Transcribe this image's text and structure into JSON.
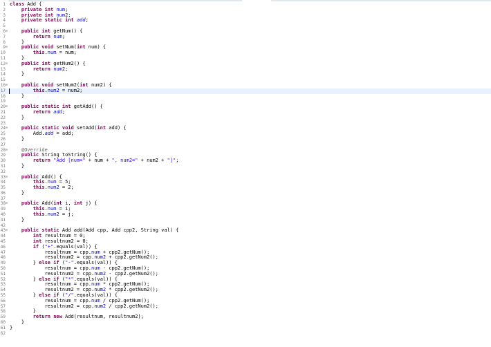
{
  "editor": {
    "colors": {
      "keyword": "#7f0055",
      "field": "#0000c0",
      "string": "#2a00ff",
      "annotation": "#646464",
      "current_line": "#e8f2fe",
      "line_number": "#787878"
    },
    "current_line_index": 16,
    "lines": [
      {
        "n": "1",
        "fold": "",
        "t": [
          [
            "kw",
            "class"
          ],
          [
            "p",
            " Add {"
          ]
        ]
      },
      {
        "n": "2",
        "fold": "",
        "t": [
          [
            "p",
            "    "
          ],
          [
            "kw",
            "private int"
          ],
          [
            "p",
            " "
          ],
          [
            "field",
            "num"
          ],
          [
            "p",
            ";"
          ]
        ]
      },
      {
        "n": "3",
        "fold": "",
        "t": [
          [
            "p",
            "    "
          ],
          [
            "kw",
            "private int"
          ],
          [
            "p",
            " "
          ],
          [
            "field",
            "num2"
          ],
          [
            "p",
            ";"
          ]
        ]
      },
      {
        "n": "4",
        "fold": "",
        "t": [
          [
            "p",
            "    "
          ],
          [
            "kw",
            "private static int"
          ],
          [
            "p",
            " "
          ],
          [
            "sfield",
            "add"
          ],
          [
            "p",
            ";"
          ]
        ]
      },
      {
        "n": "5",
        "fold": "",
        "t": [
          [
            "p",
            ""
          ]
        ]
      },
      {
        "n": "6",
        "fold": "⊖",
        "t": [
          [
            "p",
            "    "
          ],
          [
            "kw",
            "public int"
          ],
          [
            "p",
            " getNum() {"
          ]
        ]
      },
      {
        "n": "7",
        "fold": "",
        "t": [
          [
            "p",
            "        "
          ],
          [
            "kw",
            "return"
          ],
          [
            "p",
            " "
          ],
          [
            "field",
            "num"
          ],
          [
            "p",
            ";"
          ]
        ]
      },
      {
        "n": "8",
        "fold": "",
        "t": [
          [
            "p",
            "    }"
          ]
        ]
      },
      {
        "n": "9",
        "fold": "⊖",
        "t": [
          [
            "p",
            "    "
          ],
          [
            "kw",
            "public void"
          ],
          [
            "p",
            " setNum("
          ],
          [
            "kw",
            "int"
          ],
          [
            "p",
            " num) {"
          ]
        ]
      },
      {
        "n": "10",
        "fold": "",
        "t": [
          [
            "p",
            "        "
          ],
          [
            "kw",
            "this"
          ],
          [
            "p",
            "."
          ],
          [
            "field",
            "num"
          ],
          [
            "p",
            " = num;"
          ]
        ]
      },
      {
        "n": "11",
        "fold": "",
        "t": [
          [
            "p",
            "    }"
          ]
        ]
      },
      {
        "n": "12",
        "fold": "⊖",
        "t": [
          [
            "p",
            "    "
          ],
          [
            "kw",
            "public int"
          ],
          [
            "p",
            " getNum2() {"
          ]
        ]
      },
      {
        "n": "13",
        "fold": "",
        "t": [
          [
            "p",
            "        "
          ],
          [
            "kw",
            "return"
          ],
          [
            "p",
            " "
          ],
          [
            "field",
            "num2"
          ],
          [
            "p",
            ";"
          ]
        ]
      },
      {
        "n": "14",
        "fold": "",
        "t": [
          [
            "p",
            "    }"
          ]
        ]
      },
      {
        "n": "15",
        "fold": "",
        "t": [
          [
            "p",
            ""
          ]
        ]
      },
      {
        "n": "16",
        "fold": "⊖",
        "t": [
          [
            "p",
            "    "
          ],
          [
            "kw",
            "public void"
          ],
          [
            "p",
            " setNum2("
          ],
          [
            "kw",
            "int"
          ],
          [
            "p",
            " num2) {"
          ]
        ]
      },
      {
        "n": "17",
        "fold": "",
        "t": [
          [
            "p",
            "        "
          ],
          [
            "kw",
            "this"
          ],
          [
            "p",
            "."
          ],
          [
            "field",
            "num2"
          ],
          [
            "p",
            " = num2;"
          ]
        ]
      },
      {
        "n": "18",
        "fold": "",
        "t": [
          [
            "p",
            "    }"
          ]
        ]
      },
      {
        "n": "19",
        "fold": "",
        "t": [
          [
            "p",
            ""
          ]
        ]
      },
      {
        "n": "20",
        "fold": "⊖",
        "t": [
          [
            "p",
            "    "
          ],
          [
            "kw",
            "public static int"
          ],
          [
            "p",
            " getAdd() {"
          ]
        ]
      },
      {
        "n": "21",
        "fold": "",
        "t": [
          [
            "p",
            "        "
          ],
          [
            "kw",
            "return"
          ],
          [
            "p",
            " "
          ],
          [
            "sfield",
            "add"
          ],
          [
            "p",
            ";"
          ]
        ]
      },
      {
        "n": "22",
        "fold": "",
        "t": [
          [
            "p",
            "    }"
          ]
        ]
      },
      {
        "n": "23",
        "fold": "",
        "t": [
          [
            "p",
            ""
          ]
        ]
      },
      {
        "n": "24",
        "fold": "⊖",
        "t": [
          [
            "p",
            "    "
          ],
          [
            "kw",
            "public static void"
          ],
          [
            "p",
            " setAdd("
          ],
          [
            "kw",
            "int"
          ],
          [
            "p",
            " add) {"
          ]
        ]
      },
      {
        "n": "25",
        "fold": "",
        "t": [
          [
            "p",
            "        Add."
          ],
          [
            "sfield",
            "add"
          ],
          [
            "p",
            " = add;"
          ]
        ]
      },
      {
        "n": "26",
        "fold": "",
        "t": [
          [
            "p",
            "    }"
          ]
        ]
      },
      {
        "n": "27",
        "fold": "",
        "t": [
          [
            "p",
            ""
          ]
        ]
      },
      {
        "n": "28",
        "fold": "⊖",
        "t": [
          [
            "p",
            "    "
          ],
          [
            "ann",
            "@Override"
          ]
        ]
      },
      {
        "n": "29",
        "fold": "",
        "t": [
          [
            "p",
            "    "
          ],
          [
            "kw",
            "public"
          ],
          [
            "p",
            " String toString() {"
          ]
        ]
      },
      {
        "n": "30",
        "fold": "",
        "t": [
          [
            "p",
            "        "
          ],
          [
            "kw",
            "return"
          ],
          [
            "p",
            " "
          ],
          [
            "str",
            "\"Add [num=\""
          ],
          [
            "p",
            " + num + "
          ],
          [
            "str",
            "\", num2=\""
          ],
          [
            "p",
            " + num2 + "
          ],
          [
            "str",
            "\"]\""
          ],
          [
            "p",
            ";"
          ]
        ]
      },
      {
        "n": "31",
        "fold": "",
        "t": [
          [
            "p",
            "    }"
          ]
        ]
      },
      {
        "n": "32",
        "fold": "",
        "t": [
          [
            "p",
            ""
          ]
        ]
      },
      {
        "n": "33",
        "fold": "⊖",
        "t": [
          [
            "p",
            "    "
          ],
          [
            "kw",
            "public"
          ],
          [
            "p",
            " Add() {"
          ]
        ]
      },
      {
        "n": "34",
        "fold": "",
        "t": [
          [
            "p",
            "        "
          ],
          [
            "kw",
            "this"
          ],
          [
            "p",
            "."
          ],
          [
            "field",
            "num"
          ],
          [
            "p",
            " = 5;"
          ]
        ]
      },
      {
        "n": "35",
        "fold": "",
        "t": [
          [
            "p",
            "        "
          ],
          [
            "kw",
            "this"
          ],
          [
            "p",
            "."
          ],
          [
            "field",
            "num2"
          ],
          [
            "p",
            " = 2;"
          ]
        ]
      },
      {
        "n": "36",
        "fold": "",
        "t": [
          [
            "p",
            "    }"
          ]
        ]
      },
      {
        "n": "37",
        "fold": "",
        "t": [
          [
            "p",
            ""
          ]
        ]
      },
      {
        "n": "38",
        "fold": "⊖",
        "t": [
          [
            "p",
            "    "
          ],
          [
            "kw",
            "public"
          ],
          [
            "p",
            " Add("
          ],
          [
            "kw",
            "int"
          ],
          [
            "p",
            " i, "
          ],
          [
            "kw",
            "int"
          ],
          [
            "p",
            " j) {"
          ]
        ]
      },
      {
        "n": "39",
        "fold": "",
        "t": [
          [
            "p",
            "        "
          ],
          [
            "kw",
            "this"
          ],
          [
            "p",
            "."
          ],
          [
            "field",
            "num"
          ],
          [
            "p",
            " = i;"
          ]
        ]
      },
      {
        "n": "40",
        "fold": "",
        "t": [
          [
            "p",
            "        "
          ],
          [
            "kw",
            "this"
          ],
          [
            "p",
            "."
          ],
          [
            "field",
            "num2"
          ],
          [
            "p",
            " = j;"
          ]
        ]
      },
      {
        "n": "41",
        "fold": "",
        "t": [
          [
            "p",
            "    }"
          ]
        ]
      },
      {
        "n": "42",
        "fold": "",
        "t": [
          [
            "p",
            ""
          ]
        ]
      },
      {
        "n": "43",
        "fold": "⊖",
        "t": [
          [
            "p",
            "    "
          ],
          [
            "kw",
            "public static"
          ],
          [
            "p",
            " Add add(Add cpp, Add cpp2, String val) {"
          ]
        ]
      },
      {
        "n": "44",
        "fold": "",
        "t": [
          [
            "p",
            "        "
          ],
          [
            "kw",
            "int"
          ],
          [
            "p",
            " resultnum = 0;"
          ]
        ]
      },
      {
        "n": "45",
        "fold": "",
        "t": [
          [
            "p",
            "        "
          ],
          [
            "kw",
            "int"
          ],
          [
            "p",
            " resultnum2 = 0;"
          ]
        ]
      },
      {
        "n": "46",
        "fold": "",
        "t": [
          [
            "p",
            "        "
          ],
          [
            "kw",
            "if"
          ],
          [
            "p",
            " ("
          ],
          [
            "str",
            "\"+\""
          ],
          [
            "p",
            ".equals(val)) {"
          ]
        ]
      },
      {
        "n": "47",
        "fold": "",
        "t": [
          [
            "p",
            "            resultnum = cpp."
          ],
          [
            "field",
            "num"
          ],
          [
            "p",
            " + cpp2.getNum();"
          ]
        ]
      },
      {
        "n": "48",
        "fold": "",
        "t": [
          [
            "p",
            "            resultnum2 = cpp."
          ],
          [
            "field",
            "num2"
          ],
          [
            "p",
            " + cpp2.getNum2();"
          ]
        ]
      },
      {
        "n": "49",
        "fold": "",
        "t": [
          [
            "p",
            "        } "
          ],
          [
            "kw",
            "else if"
          ],
          [
            "p",
            " ("
          ],
          [
            "str",
            "\"-\""
          ],
          [
            "p",
            ".equals(val)) {"
          ]
        ]
      },
      {
        "n": "50",
        "fold": "",
        "t": [
          [
            "p",
            "            resultnum = cpp."
          ],
          [
            "field",
            "num"
          ],
          [
            "p",
            " - cpp2.getNum();"
          ]
        ]
      },
      {
        "n": "51",
        "fold": "",
        "t": [
          [
            "p",
            "            resultnum2 = cpp."
          ],
          [
            "field",
            "num2"
          ],
          [
            "p",
            " - cpp2.getNum2();"
          ]
        ]
      },
      {
        "n": "52",
        "fold": "",
        "t": [
          [
            "p",
            "        } "
          ],
          [
            "kw",
            "else if"
          ],
          [
            "p",
            " ("
          ],
          [
            "str",
            "\"*\""
          ],
          [
            "p",
            ".equals(val)) {"
          ]
        ]
      },
      {
        "n": "53",
        "fold": "",
        "t": [
          [
            "p",
            "            resultnum = cpp."
          ],
          [
            "field",
            "num"
          ],
          [
            "p",
            " * cpp2.getNum();"
          ]
        ]
      },
      {
        "n": "54",
        "fold": "",
        "t": [
          [
            "p",
            "            resultnum2 = cpp."
          ],
          [
            "field",
            "num2"
          ],
          [
            "p",
            " * cpp2.getNum2();"
          ]
        ]
      },
      {
        "n": "55",
        "fold": "",
        "t": [
          [
            "p",
            "        } "
          ],
          [
            "kw",
            "else if"
          ],
          [
            "p",
            " ("
          ],
          [
            "str",
            "\"/\""
          ],
          [
            "p",
            ".equals(val)) {"
          ]
        ]
      },
      {
        "n": "56",
        "fold": "",
        "t": [
          [
            "p",
            "            resultnum = cpp."
          ],
          [
            "field",
            "num"
          ],
          [
            "p",
            " / cpp2.getNum();"
          ]
        ]
      },
      {
        "n": "57",
        "fold": "",
        "t": [
          [
            "p",
            "            resultnum2 = cpp."
          ],
          [
            "field",
            "num2"
          ],
          [
            "p",
            " / cpp2.getNum2();"
          ]
        ]
      },
      {
        "n": "58",
        "fold": "",
        "t": [
          [
            "p",
            "        }"
          ]
        ]
      },
      {
        "n": "59",
        "fold": "",
        "t": [
          [
            "p",
            "        "
          ],
          [
            "kw",
            "return new"
          ],
          [
            "p",
            " Add(resultnum, resultnum2);"
          ]
        ]
      },
      {
        "n": "60",
        "fold": "",
        "t": [
          [
            "p",
            "    }"
          ]
        ]
      },
      {
        "n": "61",
        "fold": "",
        "t": [
          [
            "p",
            "}"
          ]
        ]
      },
      {
        "n": "62",
        "fold": "",
        "t": [
          [
            "p",
            ""
          ]
        ]
      }
    ]
  }
}
